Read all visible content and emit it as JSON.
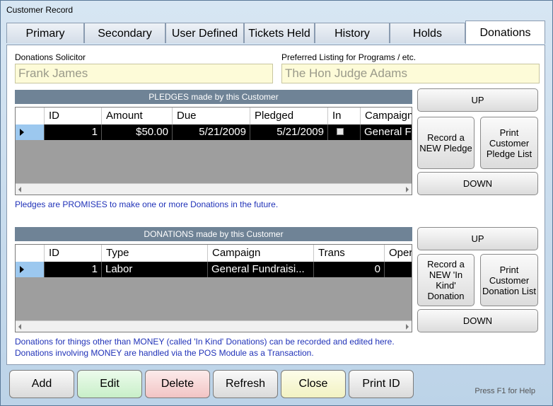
{
  "window": {
    "title": "Customer Record"
  },
  "tabs": [
    "Primary",
    "Secondary",
    "User Defined",
    "Tickets Held",
    "History",
    "Holds",
    "Donations"
  ],
  "active_tab": "Donations",
  "solicitor": {
    "label": "Donations Solicitor",
    "value": "Frank James"
  },
  "listing": {
    "label": "Preferred Listing for Programs / etc.",
    "value": "The Hon Judge Adams"
  },
  "pledges": {
    "header": "PLEDGES made by this Customer",
    "columns": [
      "ID",
      "Amount",
      "Due",
      "Pledged",
      "In",
      "Campaign"
    ],
    "rows": [
      {
        "id": "1",
        "amount": "$50.00",
        "due": "5/21/2009",
        "pledged": "5/21/2009",
        "in": false,
        "campaign": "General Fu"
      }
    ],
    "note": "Pledges are PROMISES to make one or more Donations in the future.",
    "buttons": {
      "up": "UP",
      "record": "Record a NEW Pledge",
      "print": "Print Customer Pledge List",
      "down": "DOWN"
    }
  },
  "donations": {
    "header": "DONATIONS made by this Customer",
    "columns": [
      "ID",
      "Type",
      "Campaign",
      "Trans",
      "Oper"
    ],
    "rows": [
      {
        "id": "1",
        "type": "Labor",
        "campaign": "General Fundraisi...",
        "trans": "0",
        "oper": ""
      }
    ],
    "note": "Donations for things other than MONEY (called 'In Kind' Donations) can be recorded and edited here.  Donations involving MONEY are handled via the POS Module as a Transaction.",
    "buttons": {
      "up": "UP",
      "record": "Record a NEW 'In Kind' Donation",
      "print": "Print Customer Donation List",
      "down": "DOWN"
    }
  },
  "bottom_buttons": {
    "add": "Add",
    "edit": "Edit",
    "delete": "Delete",
    "refresh": "Refresh",
    "close": "Close",
    "print_id": "Print ID"
  },
  "help": "Press F1 for Help",
  "colors": {
    "edit_button": "#d6f5d6",
    "delete_button": "#f8d3d3",
    "close_button": "#f8f8cf",
    "section_header": "#6f8396",
    "note_text": "#2032b8",
    "field_bg": "#fdfbd8"
  }
}
